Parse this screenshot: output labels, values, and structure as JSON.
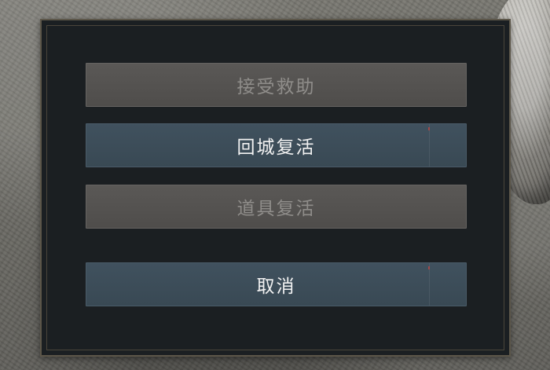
{
  "dialog": {
    "buttons": [
      {
        "label": "接受救助",
        "state": "disabled"
      },
      {
        "label": "回城复活",
        "state": "enabled"
      },
      {
        "label": "道具复活",
        "state": "disabled"
      },
      {
        "label": "取消",
        "state": "enabled"
      }
    ]
  },
  "colors": {
    "dialog_bg": "#1b1f22",
    "frame": "#5c5649",
    "enabled_button": "#40515e",
    "disabled_button": "#5a5856",
    "enabled_text": "#f2f2f2",
    "disabled_text": "#8f8d8a"
  }
}
